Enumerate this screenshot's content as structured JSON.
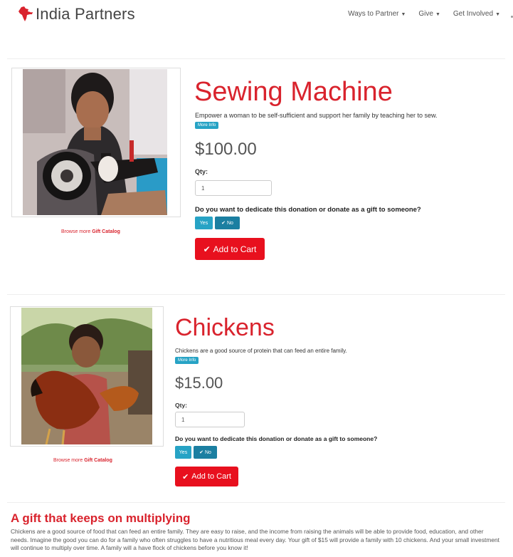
{
  "header": {
    "logo_text": "India Partners",
    "nav": [
      {
        "label": "Ways to Partner"
      },
      {
        "label": "Give"
      },
      {
        "label": "Get Involved"
      }
    ]
  },
  "products": [
    {
      "title": "Sewing Machine",
      "description": "Empower a woman to be self-sufficient and support her family by teaching her to sew.",
      "more_info_label": "More Info",
      "price": "$100.00",
      "qty_label": "Qty:",
      "qty_value": "1",
      "question": "Do you want to dedicate this donation or donate as a gift to someone?",
      "yes_label": "Yes",
      "no_label": "No",
      "add_to_cart_label": "Add to Cart",
      "browse_prefix": "Browse more ",
      "browse_link": "Gift Catalog"
    },
    {
      "title": "Chickens",
      "description": "Chickens are a good source of protein that can feed an entire family.",
      "more_info_label": "More Info",
      "price": "$15.00",
      "qty_label": "Qty:",
      "qty_value": "1",
      "question": "Do you want to dedicate this donation or donate as a gift to someone?",
      "yes_label": "Yes",
      "no_label": "No",
      "add_to_cart_label": "Add to Cart",
      "browse_prefix": "Browse more ",
      "browse_link": "Gift Catalog"
    }
  ],
  "bottom": {
    "heading": "A gift that keeps on multiplying",
    "text": "Chickens are a good source of food that can feed an entire family. They are easy to raise, and the income from raising the animals will be able to provide food, education, and other needs. Imagine the good you can do for a family who often struggles to have a nutritious meal every day. Your gift of $15 will provide a family with 10 chickens. And your small investment will continue to multiply over time. A family will a have flock of chickens before you know it!"
  },
  "colors": {
    "brand_red": "#d9232d",
    "cart_red": "#e8101e",
    "info_blue": "#27a3c5"
  }
}
